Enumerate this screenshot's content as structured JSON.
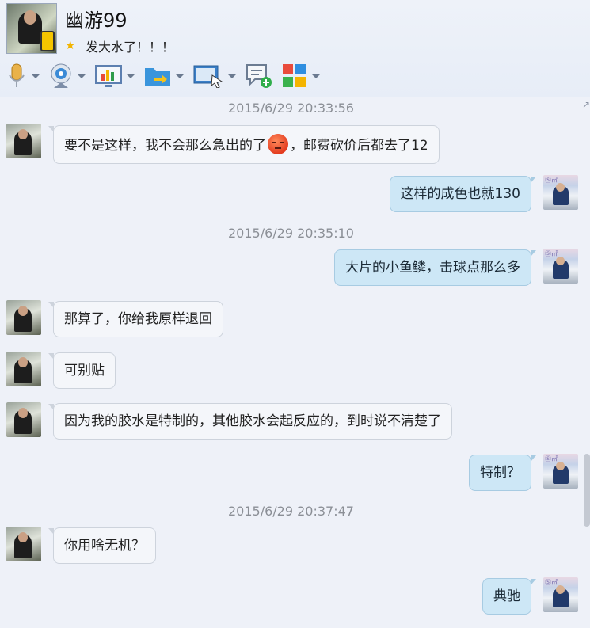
{
  "header": {
    "contact_name": "幽游99",
    "signature": "发大水了！！！"
  },
  "toolbar": {
    "tools": [
      {
        "icon": "microphone-icon"
      },
      {
        "icon": "webcam-icon"
      },
      {
        "icon": "screen-share-icon"
      },
      {
        "icon": "send-file-icon"
      },
      {
        "icon": "remote-desktop-icon"
      },
      {
        "icon": "new-message-icon"
      },
      {
        "icon": "apps-icon"
      }
    ]
  },
  "chat": {
    "timestamps": [
      "2015/6/29 20:33:56",
      "2015/6/29 20:35:10",
      "2015/6/29 20:37:47"
    ],
    "messages": [
      {
        "side": "left",
        "text_before": "要不是这样，我不会那么急出的了",
        "emoji": "angry-face-icon",
        "text_after": "，邮费砍价后都去了12"
      },
      {
        "side": "right",
        "text": "这样的成色也就130"
      },
      {
        "side": "right",
        "text": "大片的小鱼鳞，击球点那么多"
      },
      {
        "side": "left",
        "text": "那算了，你给我原样退回"
      },
      {
        "side": "left",
        "text": "可别贴"
      },
      {
        "side": "left",
        "text": "因为我的胶水是特制的，其他胶水会起反应的，到时说不清楚了"
      },
      {
        "side": "right",
        "text": "特制？"
      },
      {
        "side": "left",
        "text": "你用啥无机？"
      },
      {
        "side": "right",
        "text": "典驰"
      }
    ]
  },
  "colors": {
    "background": "#eef1f8",
    "bubble_left": "#f4f6fa",
    "bubble_right": "#cde7f6",
    "timestamp": "#8b8f96"
  }
}
